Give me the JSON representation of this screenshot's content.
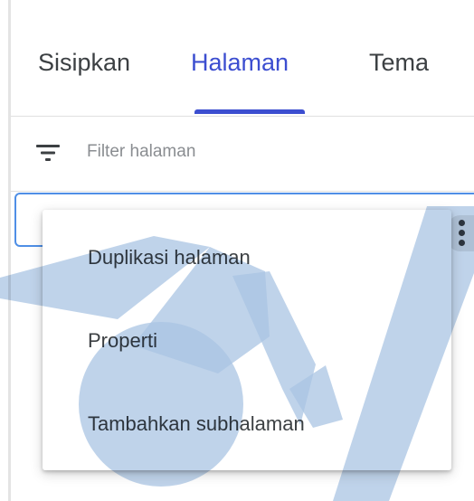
{
  "tabs": [
    {
      "label": "Sisipkan"
    },
    {
      "label": "Halaman"
    },
    {
      "label": "Tema"
    }
  ],
  "active_tab": "Halaman",
  "accent_color": "#3c4ed0",
  "filter": {
    "icon": "filter-icon",
    "placeholder": "Filter halaman",
    "value": ""
  },
  "page_item": {
    "more_icon": "more-vert-icon"
  },
  "context_menu": {
    "items": [
      {
        "label": "Duplikasi halaman"
      },
      {
        "label": "Properti"
      },
      {
        "label": "Tambahkan subhalaman"
      }
    ]
  },
  "watermark": {
    "color": "#a9c4e3",
    "icon": "graduation-cap-logo"
  }
}
